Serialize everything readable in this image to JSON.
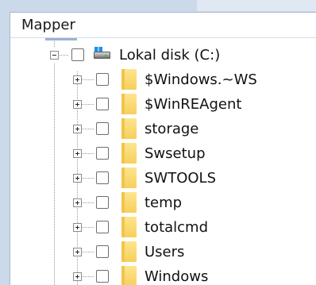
{
  "pane": {
    "title": "Mapper"
  },
  "tree": {
    "root": {
      "label": "Lokal disk (C:)",
      "icon": "drive-icon",
      "expanded": true,
      "checked": false
    },
    "children": [
      {
        "label": "$Windows.~WS",
        "icon": "folder-icon",
        "expanded": false,
        "checked": false
      },
      {
        "label": "$WinREAgent",
        "icon": "folder-icon",
        "expanded": false,
        "checked": false
      },
      {
        "label": "storage",
        "icon": "folder-icon",
        "expanded": false,
        "checked": false
      },
      {
        "label": "Swsetup",
        "icon": "folder-icon",
        "expanded": false,
        "checked": false
      },
      {
        "label": "SWTOOLS",
        "icon": "folder-icon",
        "expanded": false,
        "checked": false
      },
      {
        "label": "temp",
        "icon": "folder-icon",
        "expanded": false,
        "checked": false
      },
      {
        "label": "totalcmd",
        "icon": "folder-icon",
        "expanded": false,
        "checked": false
      },
      {
        "label": "Users",
        "icon": "folder-icon",
        "expanded": false,
        "checked": false
      },
      {
        "label": "Windows",
        "icon": "folder-icon",
        "expanded": false,
        "checked": false
      }
    ]
  },
  "colors": {
    "frame": "#ccd9ea",
    "folder": "#f7cf5b",
    "drive_accent": "#1e90e6"
  }
}
